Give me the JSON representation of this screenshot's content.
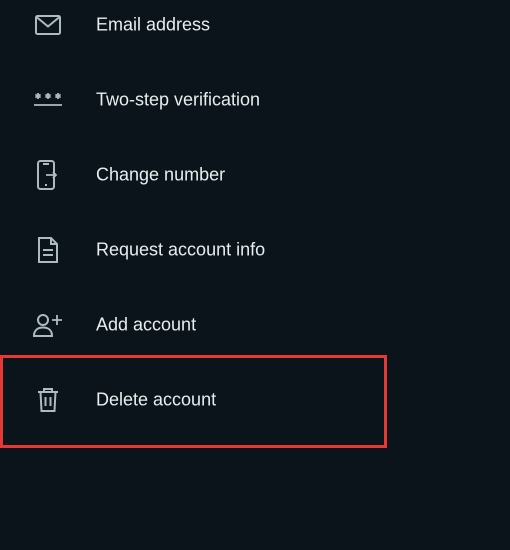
{
  "settings": {
    "items": [
      {
        "label": "Email address",
        "icon": "mail-icon"
      },
      {
        "label": "Two-step verification",
        "icon": "password-dots-icon"
      },
      {
        "label": "Change number",
        "icon": "phone-change-icon"
      },
      {
        "label": "Request account info",
        "icon": "document-icon"
      },
      {
        "label": "Add account",
        "icon": "add-person-icon"
      },
      {
        "label": "Delete account",
        "icon": "trash-icon"
      }
    ]
  },
  "colors": {
    "background": "#0b141a",
    "text": "#e9edef",
    "icon": "#aebac1",
    "highlight_border": "#e53935"
  }
}
